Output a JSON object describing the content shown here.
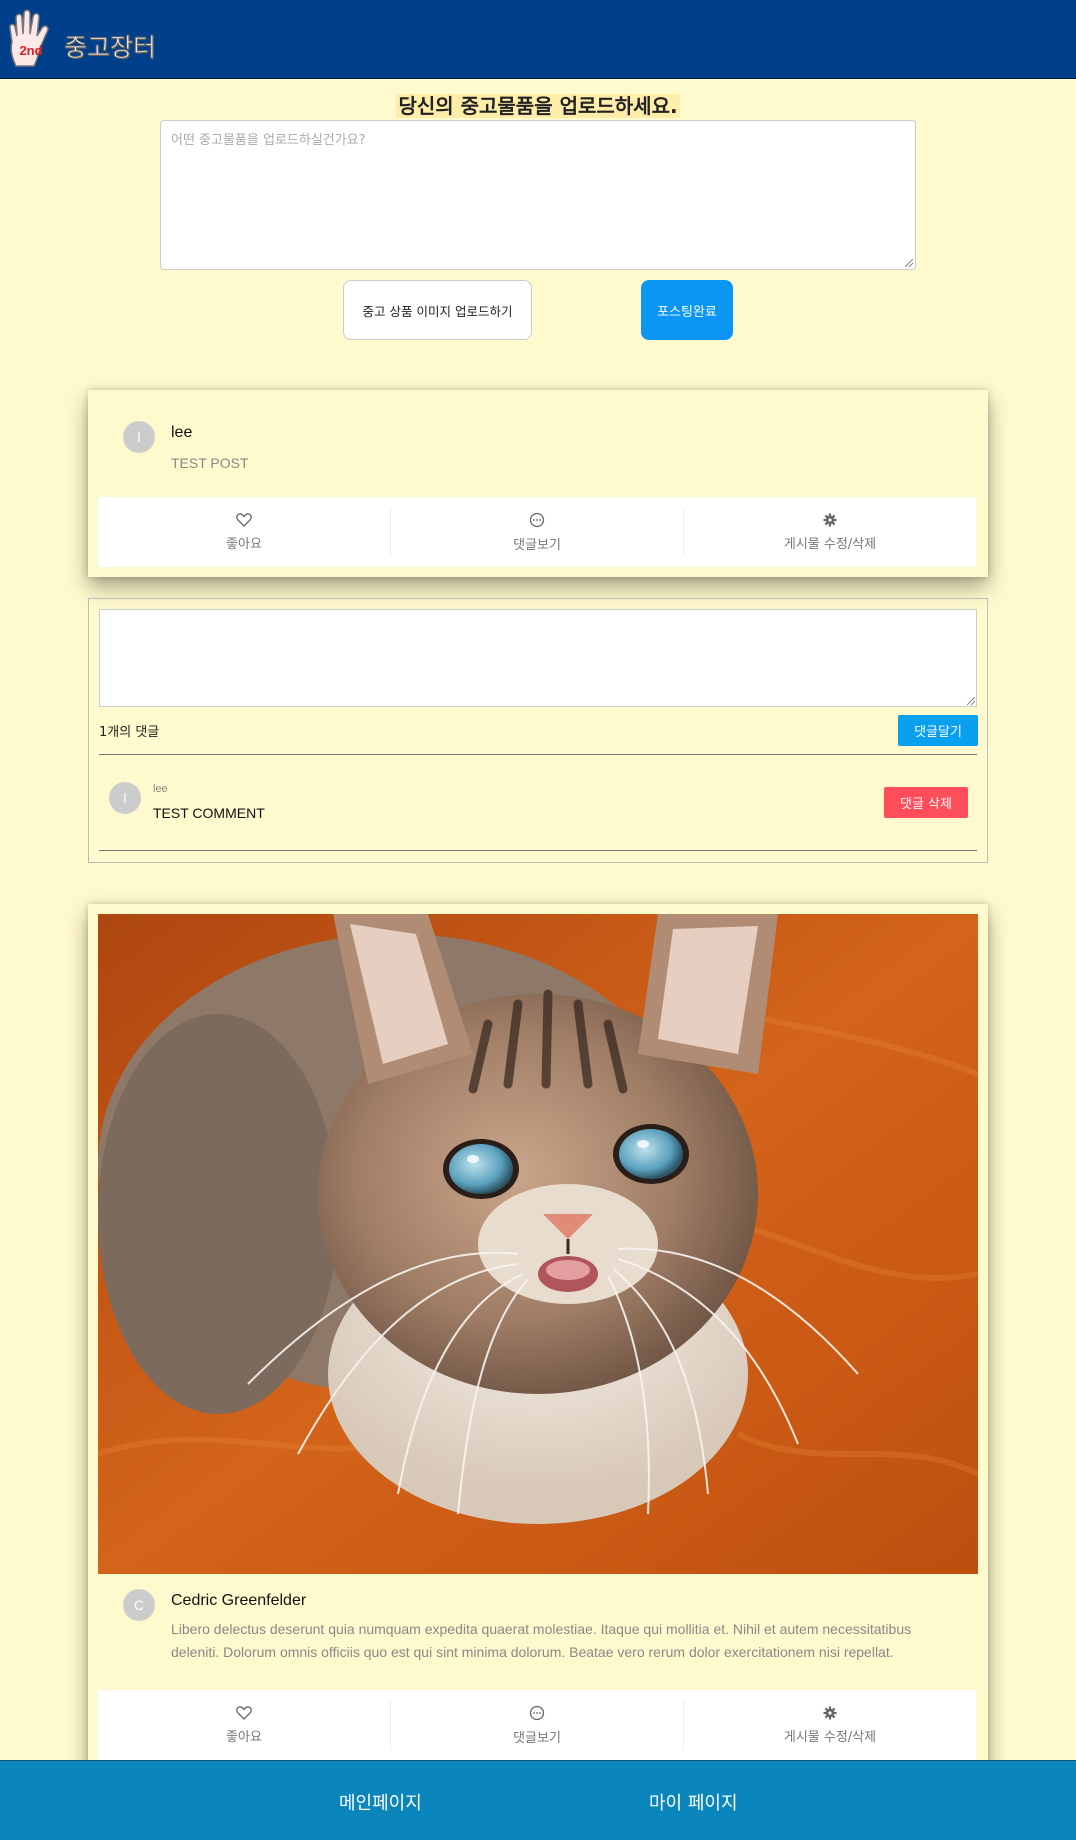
{
  "header": {
    "logo_text": "2nd",
    "brand": "중고장터"
  },
  "upload": {
    "title": "당신의 중고물품을 업로드하세요.",
    "placeholder": "어떤 중고물품을 업로드하실건가요?",
    "image_button": "중고 상품 이미지 업로드하기",
    "submit_button": "포스팅완료"
  },
  "actions": {
    "like": "좋아요",
    "comments": "댓글보기",
    "edit": "게시물 수정/삭제"
  },
  "posts": [
    {
      "avatar_initial": "l",
      "author": "lee",
      "text": "TEST POST"
    },
    {
      "avatar_initial": "C",
      "author": "Cedric Greenfelder",
      "text": "Libero delectus deserunt quia numquam expedita quaerat molestiae. Itaque qui mollitia et. Nihil et autem necessitatibus deleniti. Dolorum omnis officiis quo est qui sint minima dolorum. Beatae vero rerum dolor exercitationem nisi repellat."
    }
  ],
  "comments_section": {
    "count_label": "1개의 댓글",
    "submit_button": "댓글달기",
    "comments": [
      {
        "avatar_initial": "l",
        "author": "lee",
        "text": "TEST COMMENT",
        "delete_button": "댓글 삭제"
      }
    ]
  },
  "footer": {
    "main_page": "메인페이지",
    "my_page": "마이 페이지"
  },
  "colors": {
    "background": "#fffacd",
    "header": "#003f8a",
    "footer": "#0a86bd",
    "primary_button": "#0a96f2",
    "danger_button": "#ff4d5a"
  }
}
